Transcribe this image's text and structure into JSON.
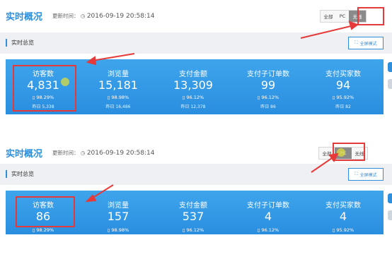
{
  "panels": [
    {
      "title": "实时概况",
      "update_label": "更新时间：",
      "update_time": "2016-09-19 20:58:14",
      "segments": [
        "全部",
        "PC",
        "无线"
      ],
      "active_segment": "无线",
      "summary_title": "实时总览",
      "fullscreen_label": "全屏模式",
      "metrics": [
        {
          "label": "访客数",
          "value": "4,831",
          "pct": "98.29%",
          "prev_label": "昨日",
          "prev_value": "5,338"
        },
        {
          "label": "浏览量",
          "value": "15,181",
          "pct": "98.98%",
          "prev_label": "昨日",
          "prev_value": "16,486"
        },
        {
          "label": "支付金额",
          "value": "13,309",
          "pct": "96.12%",
          "prev_label": "昨日",
          "prev_value": "12,378"
        },
        {
          "label": "支付子订单数",
          "value": "99",
          "pct": "96.12%",
          "prev_label": "昨日",
          "prev_value": "86"
        },
        {
          "label": "支付买家数",
          "value": "94",
          "pct": "95.92%",
          "prev_label": "昨日",
          "prev_value": "82"
        }
      ]
    },
    {
      "title": "实时概况",
      "update_label": "更新时间：",
      "update_time": "2016-09-19 20:58:14",
      "segments": [
        "全部",
        "PC",
        "无线"
      ],
      "active_segment": "PC",
      "summary_title": "实时总览",
      "fullscreen_label": "全屏模式",
      "metrics": [
        {
          "label": "访客数",
          "value": "86",
          "pct": "98.29%"
        },
        {
          "label": "浏览量",
          "value": "157",
          "pct": "98.98%"
        },
        {
          "label": "支付金额",
          "value": "537",
          "pct": "96.12%"
        },
        {
          "label": "支付子订单数",
          "value": "4",
          "pct": "96.12%"
        },
        {
          "label": "支付买家数",
          "value": "4",
          "pct": "95.92%"
        }
      ]
    }
  ],
  "icons": {
    "clock": "clock-icon",
    "phone": "phone-icon",
    "fullscreen": "fullscreen-icon"
  },
  "colors": {
    "accent": "#2f8fdb",
    "highlight": "#e63a3a",
    "panel_blue": "#2a8ee0"
  }
}
